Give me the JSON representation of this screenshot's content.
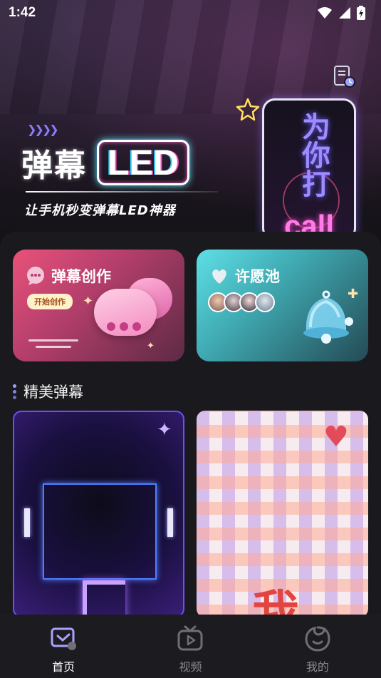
{
  "status_bar": {
    "time": "1:42"
  },
  "hero": {
    "title_cn": "弹幕",
    "title_led": "LED",
    "subtitle": "让手机秒变弹幕LED神器",
    "phone_text": "为你打",
    "phone_call": "call"
  },
  "cards": {
    "create": {
      "title": "弹幕创作",
      "button": "开始创作",
      "color": "#e9527a"
    },
    "wish": {
      "title": "许愿池",
      "color": "#5ee0e6"
    }
  },
  "section": {
    "title": "精美弹幕"
  },
  "thumbnails": {
    "neon": {
      "style": "neon-purple"
    },
    "plaid": {
      "char": "我"
    }
  },
  "nav": {
    "items": [
      {
        "label": "首页",
        "icon": "home-chat-icon",
        "active": true
      },
      {
        "label": "视频",
        "icon": "tv-icon",
        "active": false
      },
      {
        "label": "我的",
        "icon": "profile-icon",
        "active": false
      }
    ]
  }
}
